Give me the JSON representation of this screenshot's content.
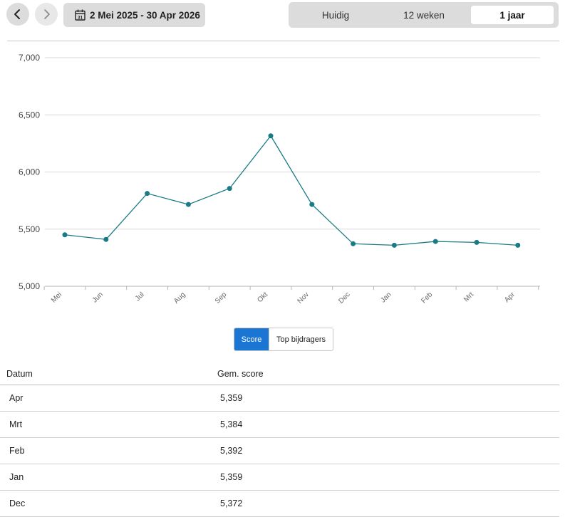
{
  "toolbar": {
    "prev_icon": "chevron-left-icon",
    "next_icon": "chevron-right-icon",
    "calendar_icon": "calendar-icon",
    "calendar_day": "31",
    "date_range": "2 Mei 2025 - 30 Apr 2026",
    "periods": [
      {
        "label": "Huidig",
        "selected": false
      },
      {
        "label": "12 weken",
        "selected": false
      },
      {
        "label": "1 jaar",
        "selected": true
      }
    ]
  },
  "colors": {
    "line": "#1a7b86",
    "grid": "#d9d9d9",
    "active_toggle": "#1b76d3"
  },
  "chart_data": {
    "type": "line",
    "categories": [
      "Mei",
      "Jun",
      "Jul",
      "Aug",
      "Sep",
      "Okt",
      "Nov",
      "Dec",
      "Jan",
      "Feb",
      "Mrt",
      "Apr"
    ],
    "values": [
      5450,
      5410,
      5812,
      5716,
      5856,
      6316,
      5716,
      5372,
      5359,
      5392,
      5384,
      5359
    ],
    "ylim": [
      5000,
      7000
    ],
    "yticks": [
      5000,
      5500,
      6000,
      6500,
      7000
    ],
    "ytick_labels": [
      "5,000",
      "5,500",
      "6,000",
      "6,500",
      "7,000"
    ],
    "grid": true,
    "title": "",
    "xlabel": "",
    "ylabel": ""
  },
  "chart_toggle": {
    "score_label": "Score",
    "contributors_label": "Top bijdragers",
    "selected": "Score"
  },
  "table": {
    "headers": [
      "Datum",
      "Gem. score"
    ],
    "rows": [
      {
        "date": "Apr",
        "score": "5,359"
      },
      {
        "date": "Mrt",
        "score": "5,384"
      },
      {
        "date": "Feb",
        "score": "5,392"
      },
      {
        "date": "Jan",
        "score": "5,359"
      },
      {
        "date": "Dec",
        "score": "5,372"
      }
    ]
  }
}
